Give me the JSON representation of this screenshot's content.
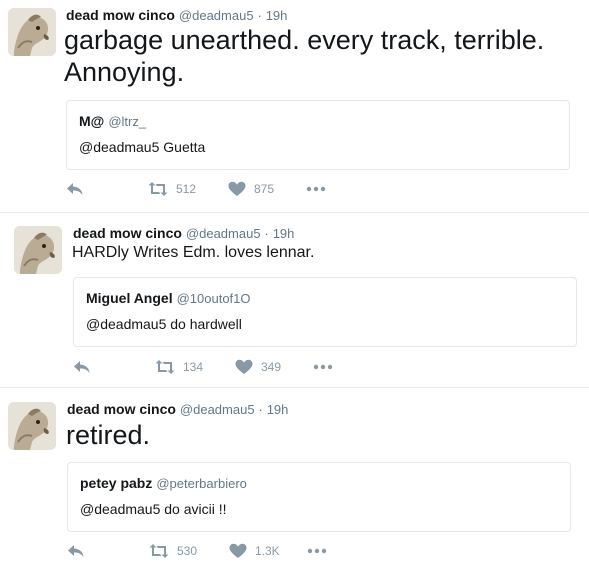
{
  "tweets": [
    {
      "name": "dead mow cinco",
      "handle": "@deadmau5",
      "separator": "·",
      "time": "19h",
      "text_line1": "garbage unearthed. every track, terrible.",
      "text_line2": "Annoying.",
      "quote": {
        "name": "M@",
        "handle": "@ltrz_",
        "text": "@deadmau5 Guetta"
      },
      "retweets": "512",
      "likes": "875"
    },
    {
      "name": "dead mow cinco",
      "handle": "@deadmau5",
      "separator": "·",
      "time": "19h",
      "text_line1": "HARDly Writes Edm. loves lennar.",
      "quote": {
        "name": "Miguel Angel",
        "handle": "@10outof1O",
        "text": "@deadmau5 do hardwell"
      },
      "retweets": "134",
      "likes": "349"
    },
    {
      "name": "dead mow cinco",
      "handle": "@deadmau5",
      "separator": "·",
      "time": "19h",
      "text_line1": "retired.",
      "quote": {
        "name": "petey pabz",
        "handle": "@peterbarbiero",
        "text": "@deadmau5 do avicii !!"
      },
      "retweets": "530",
      "likes": "1.3K"
    }
  ],
  "icons": {
    "reply": "reply-icon",
    "retweet": "retweet-icon",
    "like": "heart-icon",
    "more": "more-icon"
  },
  "colors": {
    "action_gray": "#8899a6",
    "border": "#e1e8ed"
  }
}
